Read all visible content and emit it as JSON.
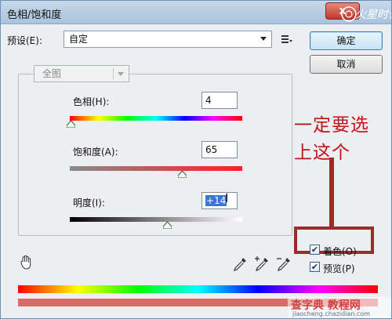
{
  "window": {
    "title": "色相/饱和度",
    "close_glyph": "x"
  },
  "logo_text": "火星时代",
  "preset": {
    "label": "预设(E):",
    "value": "自定",
    "menu_icon": "preset-options-icon"
  },
  "buttons": {
    "ok": "确定",
    "cancel": "取消"
  },
  "edit": {
    "value": "全图"
  },
  "sliders": {
    "hue": {
      "label": "色相(H):",
      "value": "4",
      "level": 0.01
    },
    "saturation": {
      "label": "饱和度(A):",
      "value": "65",
      "level": 0.65
    },
    "lightness": {
      "label": "明度(I):",
      "value": "+14",
      "level": 0.57
    }
  },
  "checkboxes": {
    "colorize": {
      "label": "着色(O)",
      "checked": true
    },
    "preview": {
      "label": "预览(P)",
      "checked": true
    }
  },
  "annotation": {
    "line1": "一定要选",
    "line2": "上这个",
    "color": "#9a2c2c"
  },
  "watermark": {
    "main": "查字典 教程网",
    "sub": "jiaocheng.chazidian.com"
  },
  "icons": [
    "hand-adjust-icon",
    "eyedropper-icon",
    "eyedropper-plus-icon",
    "eyedropper-minus-icon"
  ]
}
